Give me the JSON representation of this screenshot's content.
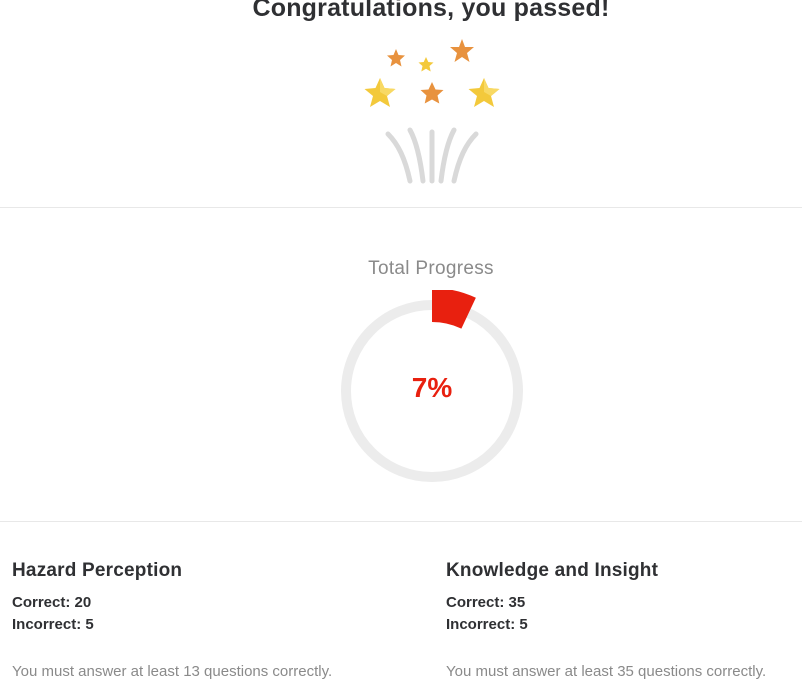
{
  "result": {
    "title": "Congratulations, you passed!"
  },
  "progress": {
    "label": "Total Progress",
    "value_text": "7%",
    "percent": 7,
    "color": "#e8200f",
    "track_color": "#ececec"
  },
  "sections": [
    {
      "title": "Hazard Perception",
      "correct_text": "Correct: 20",
      "incorrect_text": "Incorrect: 5",
      "requirement_text": "You must answer at least 13 questions correctly."
    },
    {
      "title": "Knowledge and Insight",
      "correct_text": "Correct: 35",
      "incorrect_text": "Incorrect: 5",
      "requirement_text": "You must answer at least 35 questions correctly."
    }
  ],
  "icons": {
    "celebration": "celebration-fireworks-icon"
  }
}
